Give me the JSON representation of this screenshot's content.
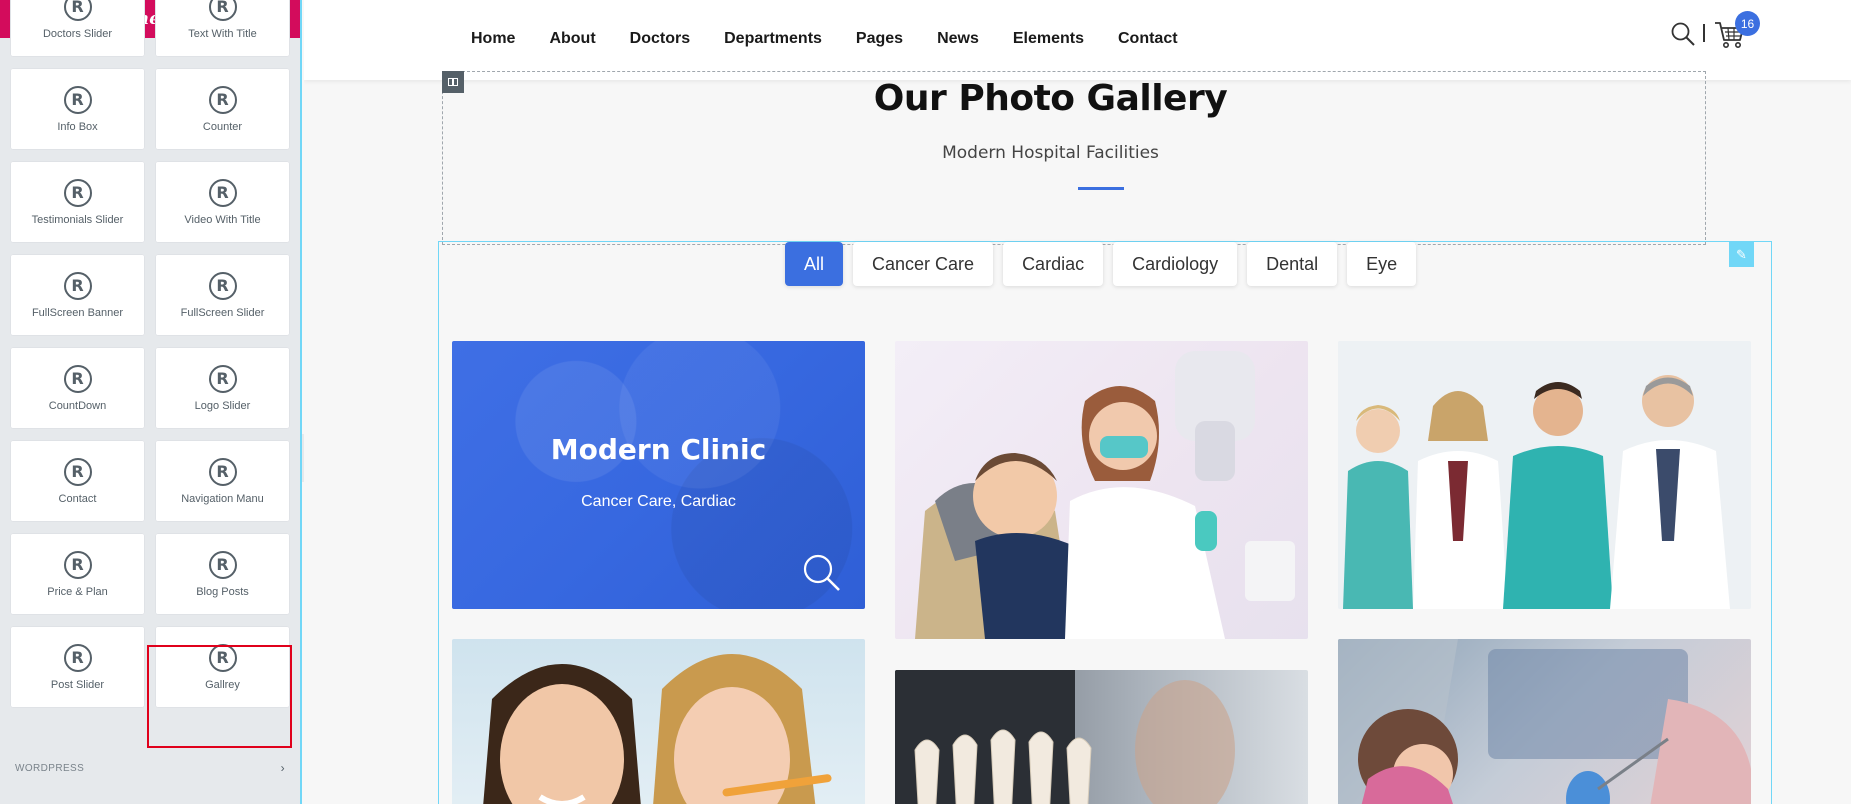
{
  "panel": {
    "brand": "elementor",
    "widgets": [
      {
        "label": "Doctors Slider",
        "name": "widget-doctors-slider"
      },
      {
        "label": "Text With Title",
        "name": "widget-text-with-title"
      },
      {
        "label": "Info Box",
        "name": "widget-info-box"
      },
      {
        "label": "Counter",
        "name": "widget-counter"
      },
      {
        "label": "Testimonials Slider",
        "name": "widget-testimonials-slider"
      },
      {
        "label": "Video With Title",
        "name": "widget-video-with-title"
      },
      {
        "label": "FullScreen Banner",
        "name": "widget-fullscreen-banner"
      },
      {
        "label": "FullScreen Slider",
        "name": "widget-fullscreen-slider"
      },
      {
        "label": "CountDown",
        "name": "widget-countdown"
      },
      {
        "label": "Logo Slider",
        "name": "widget-logo-slider"
      },
      {
        "label": "Contact",
        "name": "widget-contact"
      },
      {
        "label": "Navigation Manu",
        "name": "widget-navigation-manu"
      },
      {
        "label": "Price & Plan",
        "name": "widget-price-plan"
      },
      {
        "label": "Blog Posts",
        "name": "widget-blog-posts"
      },
      {
        "label": "Post Slider",
        "name": "widget-post-slider"
      },
      {
        "label": "Gallrey",
        "name": "widget-gallrey"
      }
    ],
    "widget_icon_glyph": "R",
    "category": "WORDPRESS",
    "highlight_color": "#e0001b",
    "header_color": "#d30c5c"
  },
  "nav": {
    "items": [
      "Home",
      "About",
      "Doctors",
      "Departments",
      "Pages",
      "News",
      "Elements",
      "Contact"
    ],
    "cart_count": "16",
    "accent": "#3b6fe0"
  },
  "gallery": {
    "title": "Our Photo Gallery",
    "subtitle": "Modern Hospital Facilities",
    "filters": [
      "All",
      "Cancer Care",
      "Cardiac",
      "Cardiology",
      "Dental",
      "Eye"
    ],
    "active_filter": "All",
    "hover_card": {
      "title": "Modern Clinic",
      "categories": "Cancer Care, Cardiac"
    }
  }
}
